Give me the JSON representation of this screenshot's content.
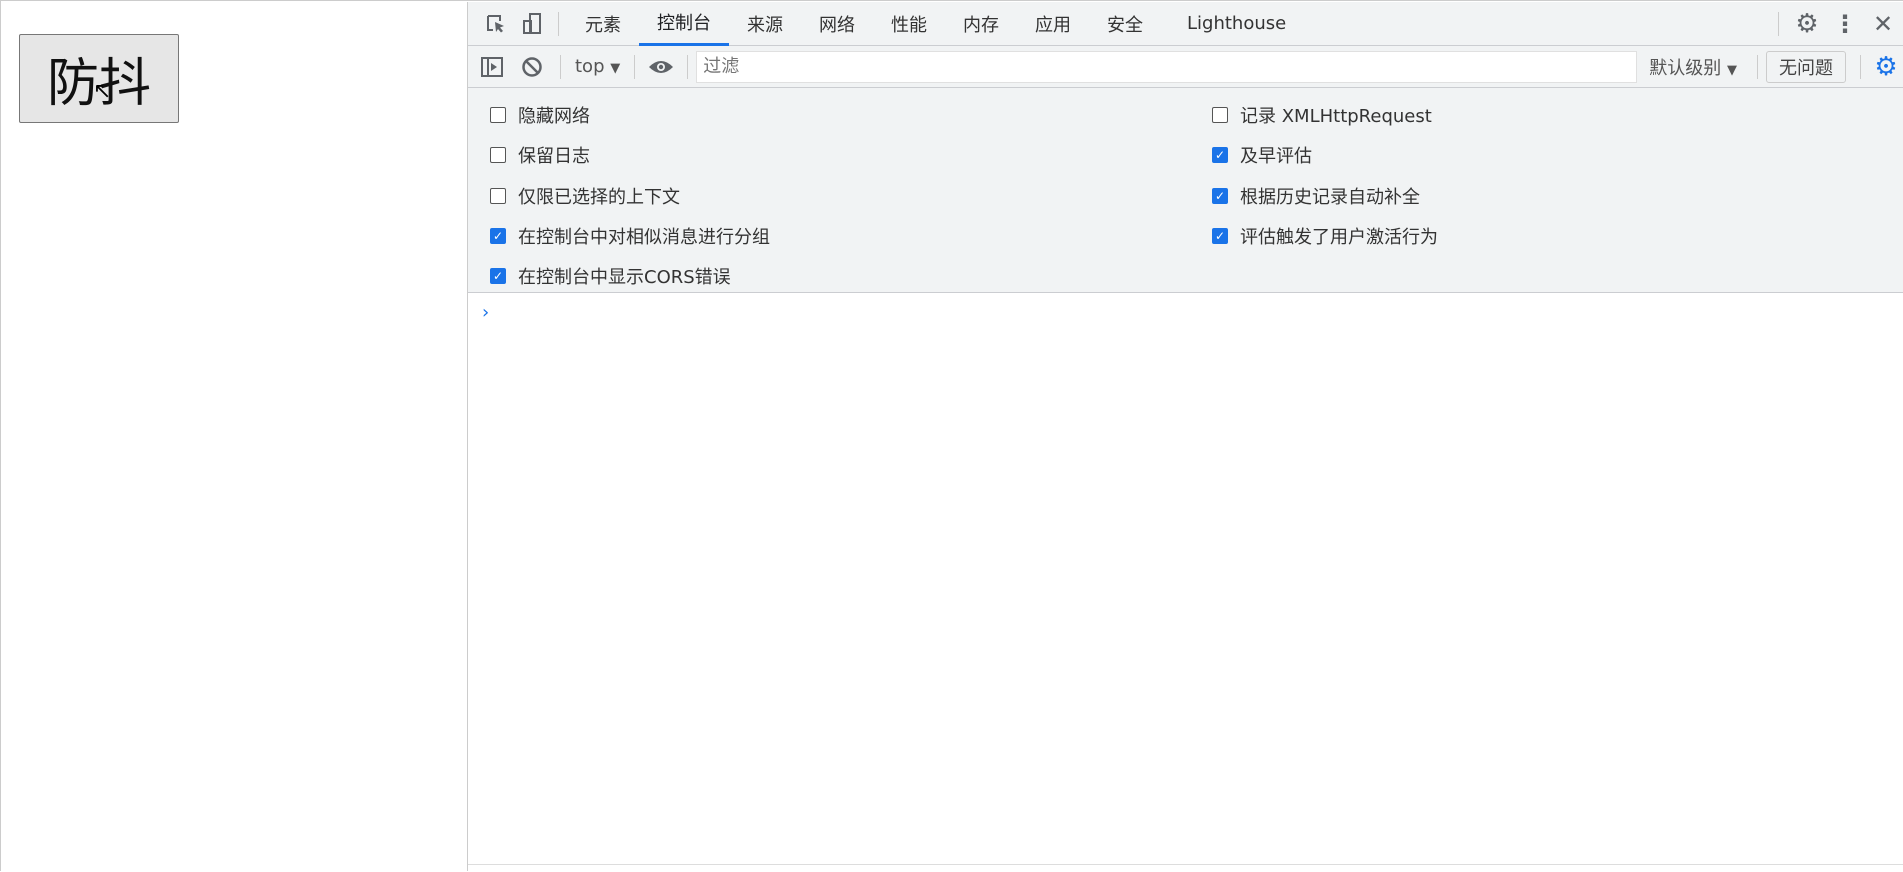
{
  "page": {
    "button_label": "防抖"
  },
  "devtools": {
    "tabs": [
      "元素",
      "控制台",
      "来源",
      "网络",
      "性能",
      "内存",
      "应用",
      "安全",
      "Lighthouse"
    ],
    "active_tab": "控制台",
    "toolbar": {
      "context": "top",
      "filter_placeholder": "过滤",
      "level": "默认级别",
      "issues": "无问题"
    },
    "settings": {
      "left": [
        {
          "label": "隐藏网络",
          "checked": false
        },
        {
          "label": "保留日志",
          "checked": false
        },
        {
          "label": "仅限已选择的上下文",
          "checked": false
        },
        {
          "label": "在控制台中对相似消息进行分组",
          "checked": true
        },
        {
          "label": "在控制台中显示CORS错误",
          "checked": true
        }
      ],
      "right": [
        {
          "label": "记录 XMLHttpRequest",
          "checked": false
        },
        {
          "label": "及早评估",
          "checked": true
        },
        {
          "label": "根据历史记录自动补全",
          "checked": true
        },
        {
          "label": "评估触发了用户激活行为",
          "checked": true
        }
      ]
    },
    "prompt": "›",
    "accent": "#1a73e8"
  }
}
